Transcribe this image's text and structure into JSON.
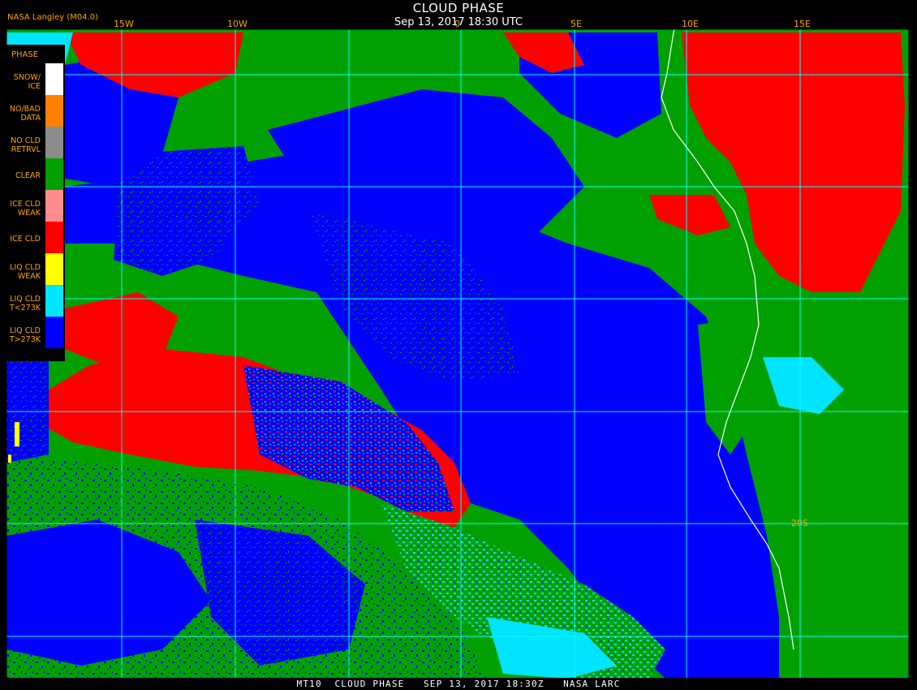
{
  "header": {
    "title": "CLOUD PHASE",
    "subtitle": "Sep 13, 2017 18:30 UTC",
    "source": "NASA Langley (M04.0)"
  },
  "legend": {
    "title": "PHASE",
    "items": [
      {
        "label1": "SNOW/",
        "label2": "ICE",
        "color": "#ffffff"
      },
      {
        "label1": "NO/BAD",
        "label2": "DATA",
        "color": "#ff7f00"
      },
      {
        "label1": "NO CLD",
        "label2": "RETRVL",
        "color": "#8c8c8c"
      },
      {
        "label1": "CLEAR",
        "label2": "",
        "color": "#00a000"
      },
      {
        "label1": "ICE CLD",
        "label2": "WEAK",
        "color": "#ff8c8c"
      },
      {
        "label1": "ICE CLD",
        "label2": "",
        "color": "#ff0000"
      },
      {
        "label1": "LIQ CLD",
        "label2": "WEAK",
        "color": "#ffff00"
      },
      {
        "label1": "LIQ CLD",
        "label2": "T<273K",
        "color": "#00e5ff"
      },
      {
        "label1": "LIQ CLD",
        "label2": "T>273K",
        "color": "#0000ff"
      }
    ]
  },
  "grid": {
    "lon_labels": [
      "15W",
      "10W",
      "0",
      "5E",
      "10E",
      "15E"
    ],
    "lat_labels": [
      "20S"
    ]
  },
  "footer": {
    "text": "MT10  CLOUD PHASE   SEP 13, 2017 18:30Z   NASA LARC"
  },
  "colors": {
    "clear": "#00a000",
    "liq_warm": "#0000ff",
    "liq_cold": "#00e5ff",
    "ice": "#ff0000",
    "no_retrieval": "#8c8c8c",
    "grid": "#00ffff",
    "coast": "#ffffff",
    "label": "#ffa500"
  }
}
